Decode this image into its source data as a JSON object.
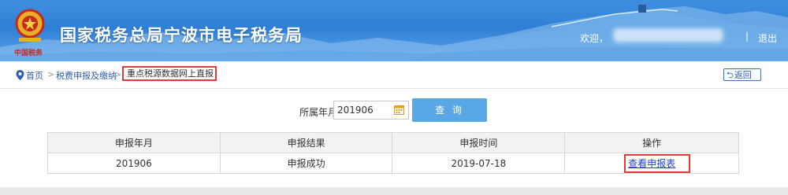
{
  "header": {
    "site_title": "国家税务总局宁波市电子税务局",
    "welcome": "欢迎，",
    "separator": "|",
    "logout": "退出",
    "emblem_caption": "中国税务"
  },
  "breadcrumb": {
    "home": "首页",
    "sep1": ">",
    "level2": "税费申报及缴纳",
    "sep2": ">",
    "current": "重点税源数据网上直报",
    "back": "返回"
  },
  "query": {
    "year_label": "所属年月:",
    "year_value": "201906",
    "button": "查 询"
  },
  "table": {
    "headers": [
      "申报年月",
      "申报结果",
      "申报时间",
      "操作"
    ],
    "rows": [
      {
        "period": "201906",
        "result": "申报成功",
        "time": "2019-07-18",
        "action": "查看申报表"
      }
    ]
  },
  "colors": {
    "header_blue": "#2f7fd6",
    "query_button": "#5aa7e6",
    "highlight_red": "#e23a3a",
    "link_blue": "#1f3fc8"
  }
}
